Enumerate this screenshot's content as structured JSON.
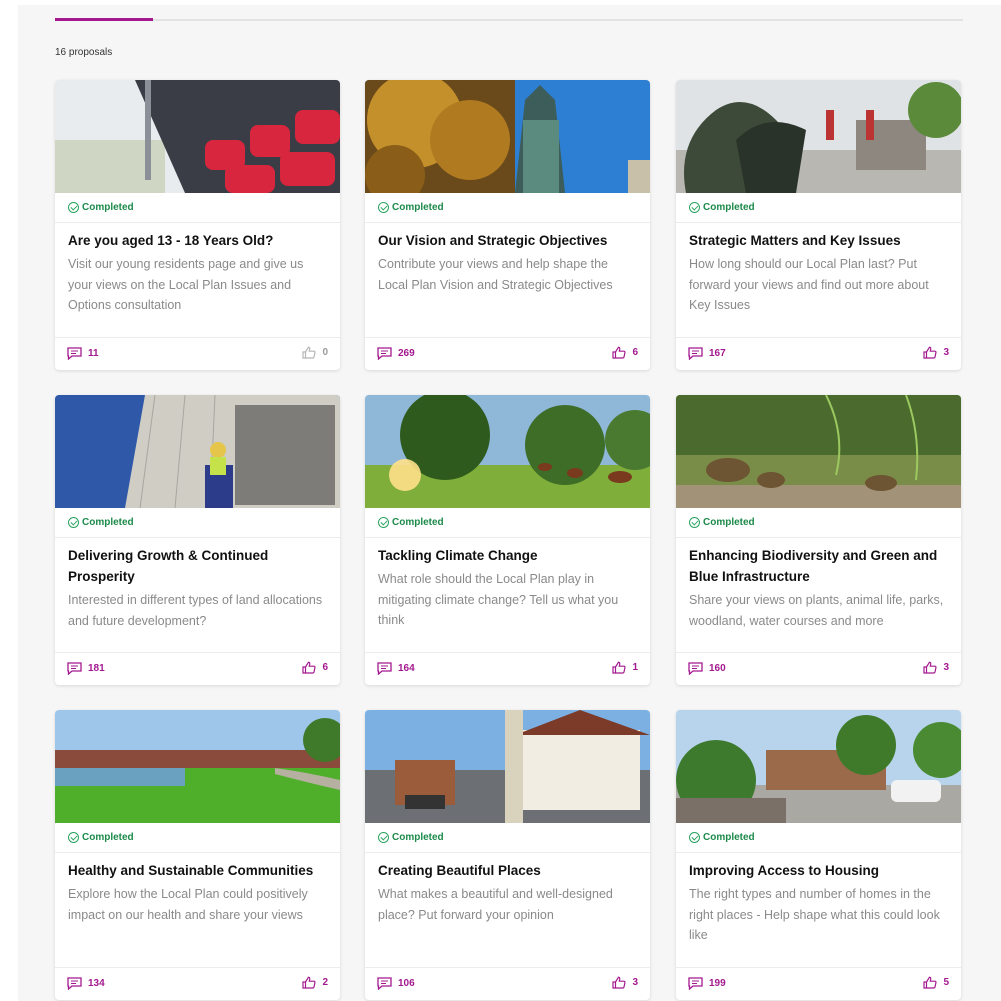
{
  "proposal_count": "16 proposals",
  "colors": {
    "accent": "#a3188f",
    "status": "#1c8a4a"
  },
  "cards": [
    {
      "status": "Completed",
      "title": "Are you aged 13 - 18 Years Old?",
      "description": "Visit our young residents page and give us your views on the Local Plan Issues and Options consultation",
      "comments": "11",
      "likes": "0"
    },
    {
      "status": "Completed",
      "title": "Our Vision and Strategic Objectives",
      "description": "Contribute your views and help shape the Local Plan Vision and Strategic Objectives",
      "comments": "269",
      "likes": "6"
    },
    {
      "status": "Completed",
      "title": "Strategic Matters and Key Issues",
      "description": "How long should our Local Plan last? Put forward your views and find out more about Key Issues",
      "comments": "167",
      "likes": "3"
    },
    {
      "status": "Completed",
      "title": "Delivering Growth & Continued Prosperity",
      "description": "Interested in different types of land allocations and future development?",
      "comments": "181",
      "likes": "6"
    },
    {
      "status": "Completed",
      "title": "Tackling Climate Change",
      "description": "What role should the Local Plan play in mitigating climate change? Tell us what you think",
      "comments": "164",
      "likes": "1"
    },
    {
      "status": "Completed",
      "title": "Enhancing Biodiversity and Green and Blue Infrastructure",
      "description": "Share your views on plants, animal life, parks, woodland, water courses and more",
      "comments": "160",
      "likes": "3"
    },
    {
      "status": "Completed",
      "title": "Healthy and Sustainable Communities",
      "description": "Explore how the Local Plan could positively impact on our health and share your views",
      "comments": "134",
      "likes": "2"
    },
    {
      "status": "Completed",
      "title": "Creating Beautiful Places",
      "description": "What makes a beautiful and well-designed place? Put forward your opinion",
      "comments": "106",
      "likes": "3"
    },
    {
      "status": "Completed",
      "title": "Improving Access to Housing",
      "description": "The right types and number of homes in the right places - Help shape what this could look like",
      "comments": "199",
      "likes": "5"
    }
  ]
}
